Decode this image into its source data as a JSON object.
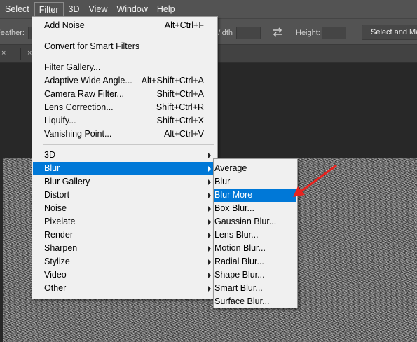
{
  "menubar": {
    "items": [
      "Select",
      "Filter",
      "3D",
      "View",
      "Window",
      "Help"
    ]
  },
  "options": {
    "feather_label": "Feather:",
    "width_label": "Width:",
    "height_label": "Height:",
    "select_mask_label": "Select and Mask..."
  },
  "tabs": {
    "close_glyph": "×"
  },
  "filter_menu": {
    "items": [
      {
        "label": "Add Noise",
        "shortcut": "Alt+Ctrl+F"
      },
      {
        "label": "Convert for Smart Filters",
        "shortcut": ""
      },
      {
        "label": "Filter Gallery...",
        "shortcut": ""
      },
      {
        "label": "Adaptive Wide Angle...",
        "shortcut": "Alt+Shift+Ctrl+A"
      },
      {
        "label": "Camera Raw Filter...",
        "shortcut": "Shift+Ctrl+A"
      },
      {
        "label": "Lens Correction...",
        "shortcut": "Shift+Ctrl+R"
      },
      {
        "label": "Liquify...",
        "shortcut": "Shift+Ctrl+X"
      },
      {
        "label": "Vanishing Point...",
        "shortcut": "Alt+Ctrl+V"
      },
      {
        "label": "3D"
      },
      {
        "label": "Blur"
      },
      {
        "label": "Blur Gallery"
      },
      {
        "label": "Distort"
      },
      {
        "label": "Noise"
      },
      {
        "label": "Pixelate"
      },
      {
        "label": "Render"
      },
      {
        "label": "Sharpen"
      },
      {
        "label": "Stylize"
      },
      {
        "label": "Video"
      },
      {
        "label": "Other"
      }
    ]
  },
  "blur_submenu": {
    "items": [
      "Average",
      "Blur",
      "Blur More",
      "Box Blur...",
      "Gaussian Blur...",
      "Lens Blur...",
      "Motion Blur...",
      "Radial Blur...",
      "Shape Blur...",
      "Smart Blur...",
      "Surface Blur..."
    ]
  },
  "colors": {
    "highlight": "#0078d7",
    "annotation_arrow": "#e8231f",
    "menu_bg": "#f0f0f0",
    "toolbar_bg": "#535353"
  }
}
